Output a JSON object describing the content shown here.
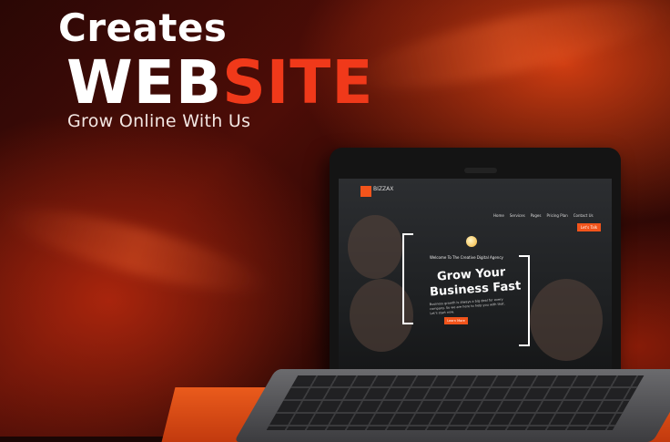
{
  "hero": {
    "line1": "Creates",
    "line2_white": "WEB",
    "line2_accent": "SITE",
    "tagline": "Grow Online With Us"
  },
  "mockup": {
    "logo_text": "BIZZAX",
    "nav": [
      "Home",
      "Services",
      "Pages",
      "Pricing Plan",
      "Contact Us"
    ],
    "cta": "Let's Talk",
    "welcome": "Welcome To The Creative Digital Agency",
    "heading_line1": "Grow Your",
    "heading_line2": "Business Fast",
    "body": "Business growth is always a big deal for every company. So we are here to help you with that. Let's start now.",
    "button": "Learn More"
  },
  "colors": {
    "accent": "#f0391a",
    "background": "#2a0705",
    "text": "#ffffff"
  }
}
